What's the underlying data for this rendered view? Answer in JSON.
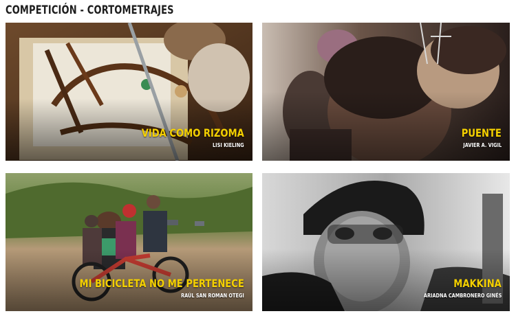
{
  "section": {
    "title": "COMPETICIÓN - CORTOMETRAJES"
  },
  "films": [
    {
      "title": "VIDA COMO RIZOMA",
      "director": "LISI KIELING",
      "accent": "#f4d000"
    },
    {
      "title": "PUENTE",
      "director": "JAVIER A. VIGIL",
      "accent": "#f4d000"
    },
    {
      "title": "MI BICICLETA NO ME PERTENECE",
      "director": "RAÚL SAN ROMAN OTEGI",
      "accent": "#f4d000"
    },
    {
      "title": "MAKKINA",
      "director": "ARIADNA CAMBRONERO GINÉS",
      "accent": "#f4d000"
    }
  ]
}
